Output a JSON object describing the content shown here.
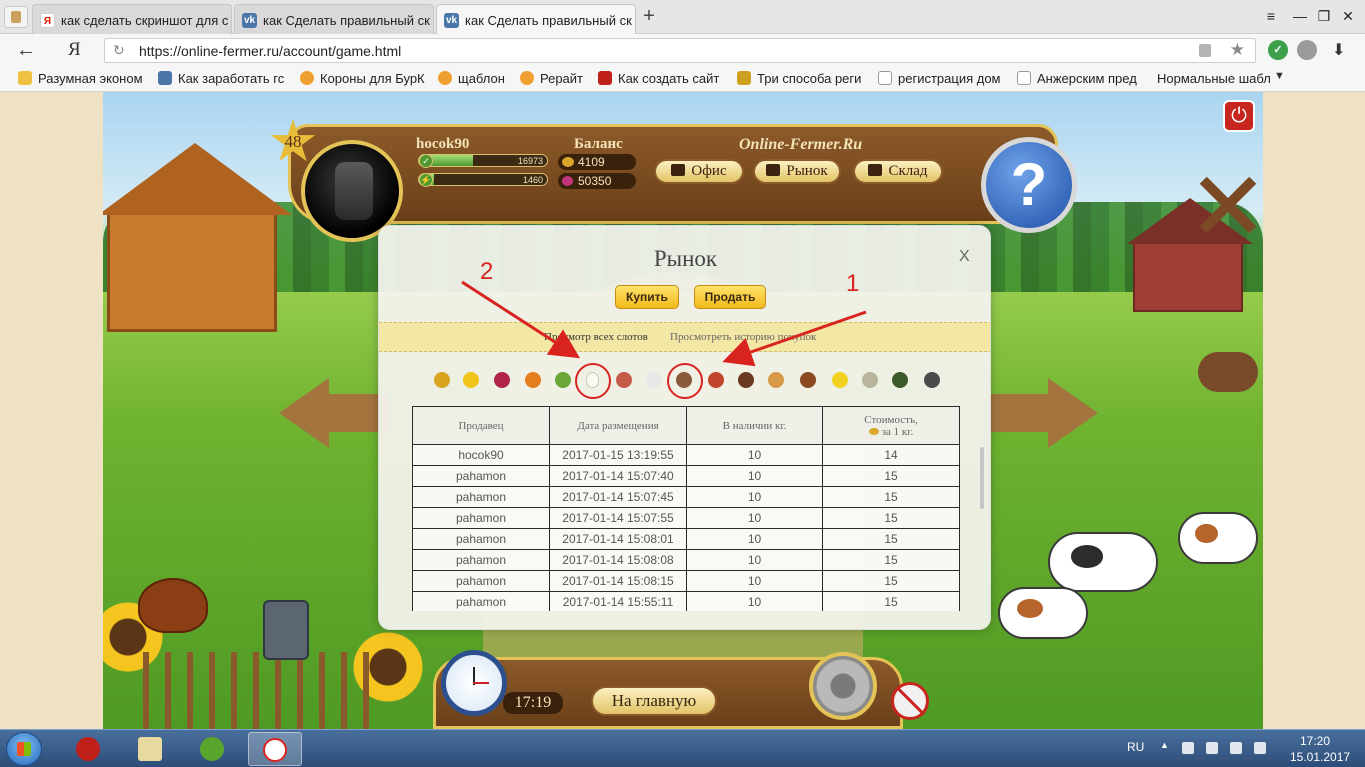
{
  "browser": {
    "tabs": [
      {
        "title": "как сделать скриншот для с",
        "icon": "yandex-icon"
      },
      {
        "title": "как Сделать правильный ск",
        "icon": "vk-icon"
      },
      {
        "title": "как Сделать правильный ск",
        "icon": "vk-icon"
      }
    ],
    "new_tab": "+",
    "url": "https://online-fermer.ru/account/game.html",
    "logo": "Я",
    "bookmarks": [
      "Разумная эконом",
      "Как заработать гс",
      "Короны для БурК",
      "щаблон",
      "Рерайт",
      "Как создать сайт",
      "Три способа реги",
      "регистрация дом",
      "Анжерским пред",
      "Нормальные шабл"
    ]
  },
  "game": {
    "level": "48",
    "username": "hocok90",
    "xp_value": "16973",
    "xp_fill": 0.42,
    "energy_value": "1460",
    "energy_fill": 0.12,
    "balance_label": "Баланс",
    "coins": "4109",
    "gems": "50350",
    "site_title": "Online-Fermer.Ru",
    "nav": {
      "office": "Офис",
      "market": "Рынок",
      "storage": "Склад"
    },
    "help": "?",
    "time": "17:19",
    "home": "На главную"
  },
  "market": {
    "title": "Рынок",
    "close": "X",
    "buy": "Купить",
    "sell": "Продать",
    "view_all": "Просмотр всех слотов",
    "history": "Просмотреть историю покупок",
    "columns": [
      "Продавец",
      "Дата размещения",
      "В наличии кг.",
      "Стоимость,",
      "за 1 кг."
    ],
    "rows": [
      [
        "hocok90",
        "2017-01-15 13:19:55",
        "10",
        "14"
      ],
      [
        "pahamon",
        "2017-01-14 15:07:40",
        "10",
        "15"
      ],
      [
        "pahamon",
        "2017-01-14 15:07:45",
        "10",
        "15"
      ],
      [
        "pahamon",
        "2017-01-14 15:07:55",
        "10",
        "15"
      ],
      [
        "pahamon",
        "2017-01-14 15:08:01",
        "10",
        "15"
      ],
      [
        "pahamon",
        "2017-01-14 15:08:08",
        "10",
        "15"
      ],
      [
        "pahamon",
        "2017-01-14 15:08:15",
        "10",
        "15"
      ],
      [
        "pahamon",
        "2017-01-14 15:55:11",
        "10",
        "15"
      ]
    ],
    "products": [
      {
        "name": "wheat-icon",
        "color": "#d9a21f"
      },
      {
        "name": "corn-icon",
        "color": "#f0c419"
      },
      {
        "name": "beet-icon",
        "color": "#b0244a"
      },
      {
        "name": "pumpkin-icon",
        "color": "#e67d1c"
      },
      {
        "name": "pea-icon",
        "color": "#6aa63a"
      },
      {
        "name": "egg-icon",
        "color": "#fbfbf3"
      },
      {
        "name": "meat-icon",
        "color": "#c45a4a"
      },
      {
        "name": "milk-icon",
        "color": "#e8e8e8"
      },
      {
        "name": "flour-icon",
        "color": "#8a5a3a"
      },
      {
        "name": "sausage-icon",
        "color": "#c2442e"
      },
      {
        "name": "jug-icon",
        "color": "#6a3a20"
      },
      {
        "name": "bread-icon",
        "color": "#d99a4a"
      },
      {
        "name": "loaf-icon",
        "color": "#8a4a1e"
      },
      {
        "name": "cheese-icon",
        "color": "#f2d21f"
      },
      {
        "name": "sack-icon",
        "color": "#b9b49c"
      },
      {
        "name": "leaves-icon",
        "color": "#3d5a2a"
      },
      {
        "name": "bag-icon",
        "color": "#4a4a4a"
      }
    ]
  },
  "annotations": {
    "one": "1",
    "two": "2"
  },
  "taskbar": {
    "lang": "RU",
    "time": "17:20",
    "date": "15.01.2017"
  }
}
